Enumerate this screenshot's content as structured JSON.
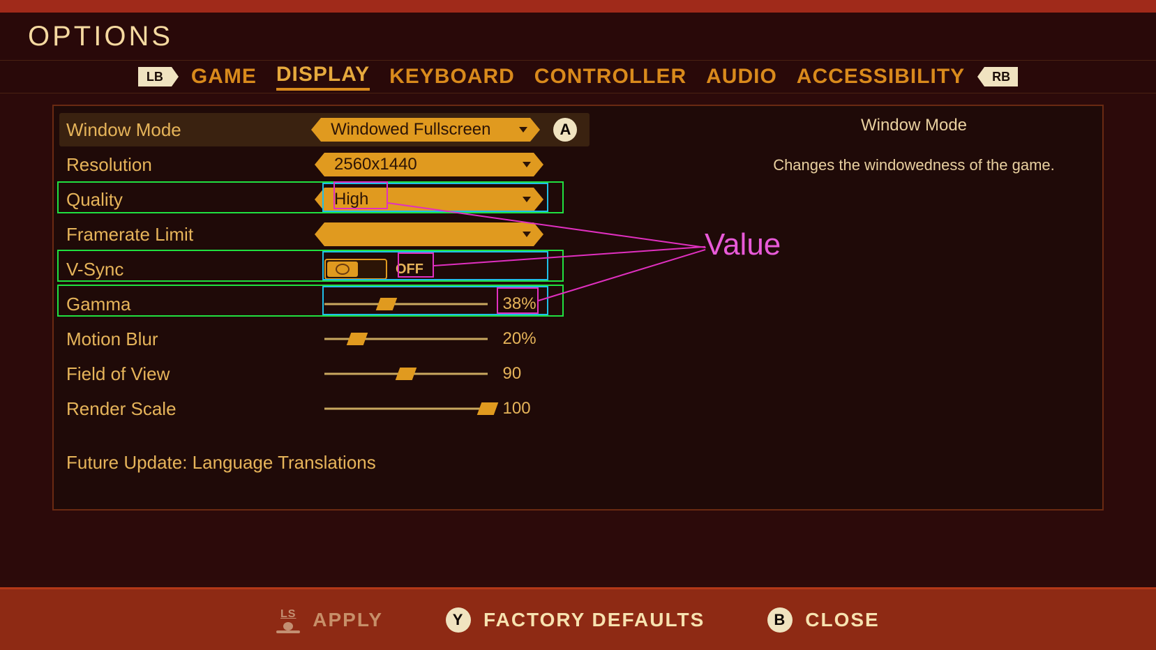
{
  "header": {
    "title": "OPTIONS"
  },
  "tabs": {
    "lb": "LB",
    "rb": "RB",
    "items": [
      "GAME",
      "DISPLAY",
      "KEYBOARD",
      "CONTROLLER",
      "AUDIO",
      "ACCESSIBILITY"
    ],
    "active_index": 1
  },
  "description": {
    "title": "Window Mode",
    "text": "Changes the windowedness of the game."
  },
  "settings": {
    "window_mode": {
      "label": "Window Mode",
      "value": "Windowed Fullscreen",
      "a_glyph": "A"
    },
    "resolution": {
      "label": "Resolution",
      "value": "2560x1440"
    },
    "quality": {
      "label": "Quality",
      "value": "High"
    },
    "framerate": {
      "label": "Framerate Limit",
      "value": ""
    },
    "vsync": {
      "label": "V-Sync",
      "value": "OFF",
      "on": false
    },
    "gamma": {
      "label": "Gamma",
      "value": 38,
      "display": "38%"
    },
    "motion_blur": {
      "label": "Motion Blur",
      "value": 20,
      "display": "20%"
    },
    "fov": {
      "label": "Field of View",
      "value": 90,
      "display": "90",
      "min": 60,
      "max": 120
    },
    "render_scale": {
      "label": "Render Scale",
      "value": 100,
      "display": "100"
    }
  },
  "future_note": "Future Update: Language Translations",
  "footer": {
    "apply": "APPLY",
    "apply_glyph": "LS",
    "defaults": "FACTORY DEFAULTS",
    "defaults_glyph": "Y",
    "close": "CLOSE",
    "close_glyph": "B"
  },
  "annotation": {
    "label": "Value"
  }
}
